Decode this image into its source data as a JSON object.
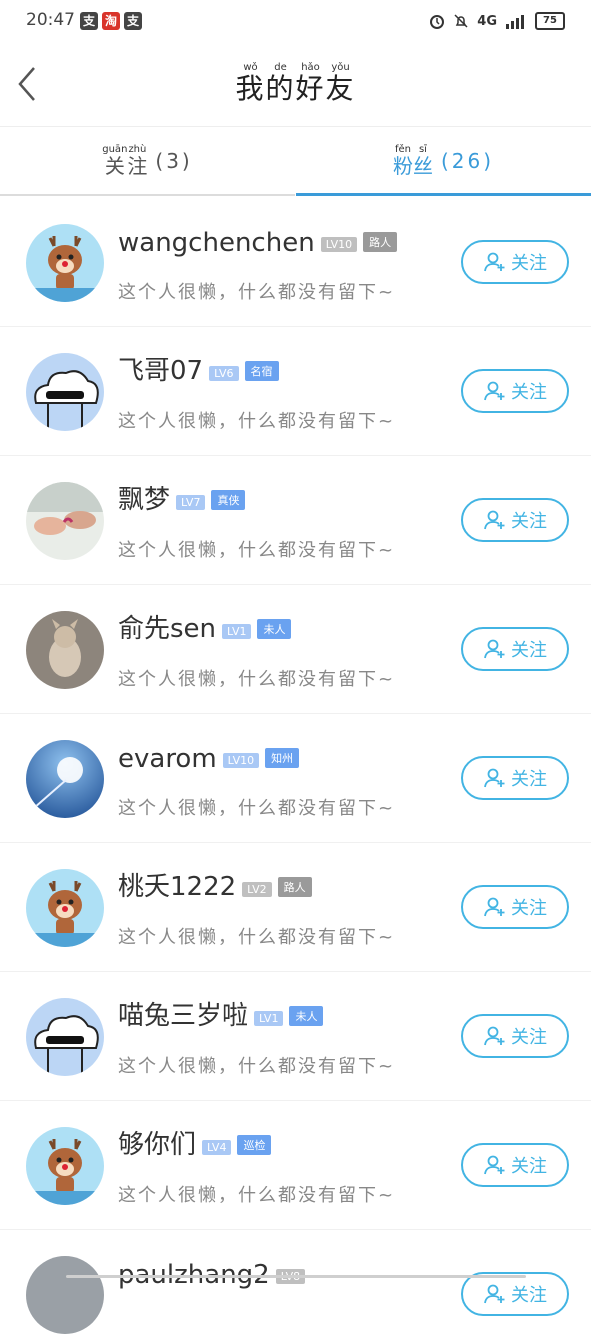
{
  "status_bar": {
    "time": "20:47",
    "apps": [
      "支",
      "淘",
      "支"
    ],
    "network": "4G",
    "battery": "75"
  },
  "header": {
    "title": "我的好友",
    "title_pinyin": [
      "wǒ",
      "de",
      "hǎo",
      "yǒu"
    ]
  },
  "tabs": [
    {
      "label": "关注",
      "pinyin": [
        "guān",
        "zhù"
      ],
      "count": "(3)",
      "active": false
    },
    {
      "label": "粉丝",
      "pinyin": [
        "fěn",
        "sī"
      ],
      "count": "(26)",
      "active": true
    }
  ],
  "signature_default": "这个人很懒，什么都没有留下~",
  "follow_label": "关注",
  "users": [
    {
      "name": "wangchenchen",
      "level": "LV10",
      "rank": "路人",
      "avatar": "deer-avatar"
    },
    {
      "name": "飞哥07",
      "level": "LV6",
      "rank": "名宿",
      "avatar": "cloud-avatar"
    },
    {
      "name": "飘梦",
      "level": "LV7",
      "rank": "真侠",
      "avatar": "hands-photo-avatar"
    },
    {
      "name": "俞先sen",
      "level": "LV1",
      "rank": "未人",
      "avatar": "cat-photo-avatar"
    },
    {
      "name": "evarom",
      "level": "LV10",
      "rank": "知州",
      "avatar": "dandelion-photo-avatar"
    },
    {
      "name": "桃夭1222",
      "level": "LV2",
      "rank": "路人",
      "avatar": "deer-avatar"
    },
    {
      "name": "喵兔三岁啦",
      "level": "LV1",
      "rank": "未人",
      "avatar": "cloud-avatar"
    },
    {
      "name": "够你们",
      "level": "LV4",
      "rank": "巡检",
      "avatar": "deer-avatar"
    },
    {
      "name": "paulzhang2",
      "level": "LV8",
      "rank": "",
      "avatar": "gray-avatar"
    }
  ],
  "colors": {
    "accent": "#3a9bd9",
    "button_border": "#42b4e3"
  }
}
